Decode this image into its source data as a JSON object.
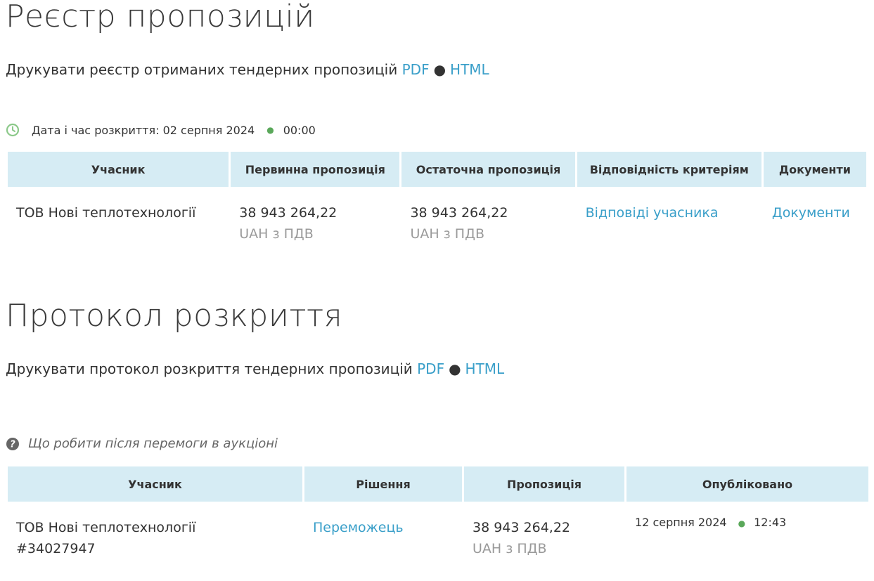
{
  "registry": {
    "title": "Реєстр пропозицій",
    "print_text": "Друкувати реєстр отриманих тендерних пропозицій",
    "pdf_label": "PDF",
    "separator": "●",
    "html_label": "HTML",
    "icon": "clock-icon",
    "opening_label": "Дата і час розкриття: 02 серпня 2024",
    "opening_time": "00:00",
    "columns": [
      "Учасник",
      "Первинна пропозиція",
      "Остаточна пропозиція",
      "Відповідність критеріям",
      "Документи"
    ],
    "rows": [
      {
        "participant": "ТОВ Нові теплотехнології",
        "initial_amount": "38 943 264,22",
        "initial_currency": "UAH з ПДВ",
        "final_amount": "38 943 264,22",
        "final_currency": "UAH з ПДВ",
        "criteria_link": "Відповіді учасника",
        "documents_link": "Документи"
      }
    ]
  },
  "protocol": {
    "title": "Протокол розкриття",
    "print_text": "Друкувати протокол розкриття тендерних пропозицій",
    "pdf_label": "PDF",
    "separator": "●",
    "html_label": "HTML",
    "help_icon": "question-circle-icon",
    "help_text": "Що робити після перемоги в аукціоні",
    "columns": [
      "Учасник",
      "Рішення",
      "Пропозиція",
      "Опубліковано"
    ],
    "rows": [
      {
        "participant": "ТОВ Нові теплотехнології",
        "participant_code": "#34027947",
        "decision": "Переможець",
        "amount": "38 943 264,22",
        "currency": "UAH з ПДВ",
        "published_date": "12 серпня 2024",
        "published_time": "12:43"
      }
    ]
  },
  "colors": {
    "link": "#3a9fc9",
    "header_bg": "#d6ecf4",
    "accent_green": "#5aa85a",
    "muted": "#9a9a9a"
  }
}
